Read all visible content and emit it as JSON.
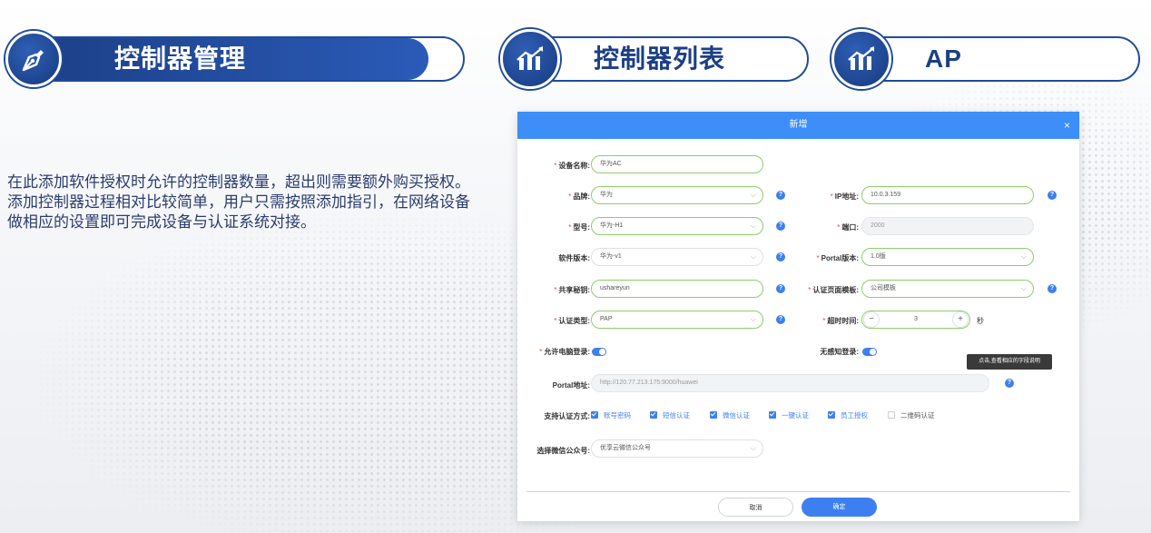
{
  "headers": {
    "controller_mgmt": "控制器管理",
    "controller_list": "控制器列表",
    "ap": "AP"
  },
  "description": "在此添加软件授权时允许的控制器数量，超出则需要额外购买授权。添加控制器过程相对比较简单，用户只需按照添加指引，在网络设备做相应的设置即可完成设备与认证系统对接。",
  "modal": {
    "title": "新增",
    "close": "×",
    "fields": {
      "device_name": {
        "label": "设备名称:",
        "value": "华为AC"
      },
      "brand": {
        "label": "品牌:",
        "value": "华为"
      },
      "ip": {
        "label": "IP地址:",
        "value": "10.0.3.159"
      },
      "model": {
        "label": "型号:",
        "value": "华为-H1"
      },
      "port": {
        "label": "端口:",
        "value": "2000"
      },
      "software_version": {
        "label": "软件版本:",
        "value": "华为-v1"
      },
      "portal_version": {
        "label": "Portal版本:",
        "value": "1.0版"
      },
      "shared_secret": {
        "label": "共享秘钥:",
        "value": "ushareyun"
      },
      "auth_page_template": {
        "label": "认证页面模板:",
        "value": "公司模板"
      },
      "auth_type": {
        "label": "认证类型:",
        "value": "PAP"
      },
      "timeout": {
        "label": "超时时间:",
        "value": "3",
        "unit": "秒",
        "minus": "−",
        "plus": "+"
      },
      "allow_pc_login": {
        "label": "允许电脑登录:",
        "on": true
      },
      "silent_login": {
        "label": "无感知登录:",
        "on": true
      },
      "portal_url": {
        "label": "Portal地址:",
        "value": "http://120.77.213.175:9000/huawei"
      },
      "supported_auth": {
        "label": "支持认证方式:",
        "options": [
          {
            "label": "账号密码",
            "checked": true
          },
          {
            "label": "短信认证",
            "checked": true
          },
          {
            "label": "微信认证",
            "checked": true
          },
          {
            "label": "一键认证",
            "checked": true
          },
          {
            "label": "员工授权",
            "checked": true
          },
          {
            "label": "二维码认证",
            "checked": false
          }
        ]
      },
      "wechat_account": {
        "label": "选择微信公众号:",
        "value": "优享云微信公众号"
      }
    },
    "tooltip": "点击,查看相应的字段说明",
    "help_glyph": "?",
    "chevron_glyph": "⌵",
    "cancel": "取消",
    "confirm": "确定"
  },
  "colors": {
    "primary": "#3d8ef8",
    "header_blue": "#1f4b9c",
    "required": "#e64545",
    "valid_border": "#8fcc6b"
  }
}
